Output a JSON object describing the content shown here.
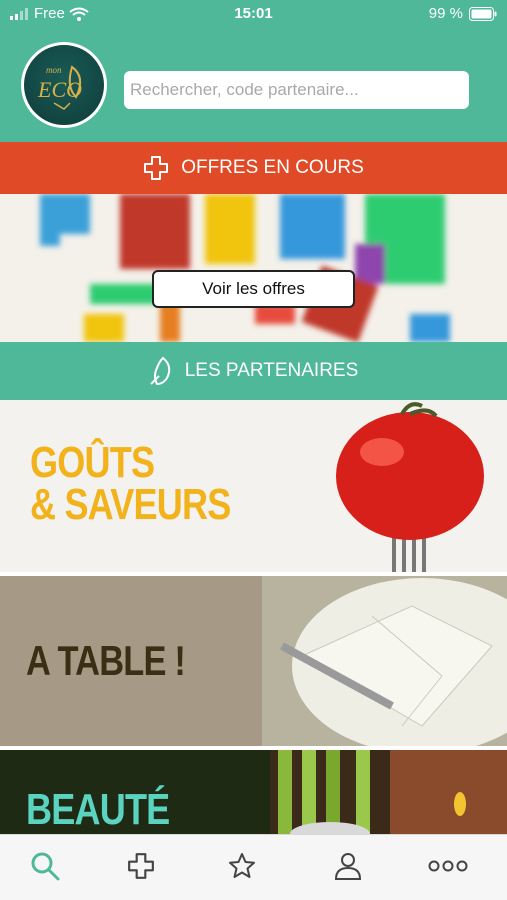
{
  "status_bar": {
    "carrier": "Free",
    "time": "15:01",
    "battery": "99 %"
  },
  "header": {
    "logo_text": "mon ECO",
    "search_placeholder": "Rechercher, code partenaire..."
  },
  "offers": {
    "bar_label": "OFFRES EN COURS",
    "bar_icon": "cross-outline-icon",
    "button_label": "Voir les offres"
  },
  "partners": {
    "bar_label": "LES PARTENAIRES",
    "bar_icon": "leaf-icon"
  },
  "categories": [
    {
      "line1": "GOÛTS",
      "line2": "& SAVEURS",
      "color": "#f2b21b"
    },
    {
      "line1": "A TABLE !",
      "line2": "",
      "color": "#3a2f14"
    },
    {
      "line1": "BEAUTÉ",
      "line2": "",
      "color": "#5ad4c0"
    }
  ],
  "tab_bar": {
    "items": [
      "search-icon",
      "cross-outline-icon",
      "star-icon",
      "user-icon",
      "more-icon"
    ],
    "active_color": "#4fb899"
  },
  "colors": {
    "primary": "#4fb899",
    "offers_red": "#e14a26"
  }
}
